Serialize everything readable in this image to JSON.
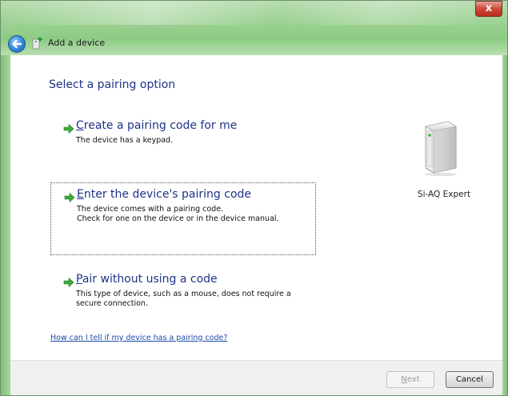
{
  "window": {
    "title": "Add a device",
    "close_glyph": "x"
  },
  "main": {
    "heading": "Select a pairing option",
    "options": [
      {
        "icon": "green-arrow-icon",
        "accesskey": "C",
        "label_rest": "reate a pairing code for me",
        "description": [
          "The device has a keypad."
        ]
      },
      {
        "icon": "green-arrow-icon",
        "accesskey": "E",
        "label_rest": "nter the device's pairing code",
        "description": [
          "The device comes with a pairing code.",
          "Check for one on the device or in the device manual."
        ]
      },
      {
        "icon": "green-arrow-icon",
        "accesskey": "P",
        "label_rest": "air without using a code",
        "description": [
          "This type of device, such as a mouse, does not require a",
          "secure connection."
        ]
      }
    ],
    "help_link": "How can I tell if my device has a pairing code?"
  },
  "device": {
    "icon": "computer-tower-icon",
    "label": "Si-AQ Expert"
  },
  "footer": {
    "next_accesskey": "N",
    "next_rest": "ext",
    "cancel": "Cancel"
  }
}
